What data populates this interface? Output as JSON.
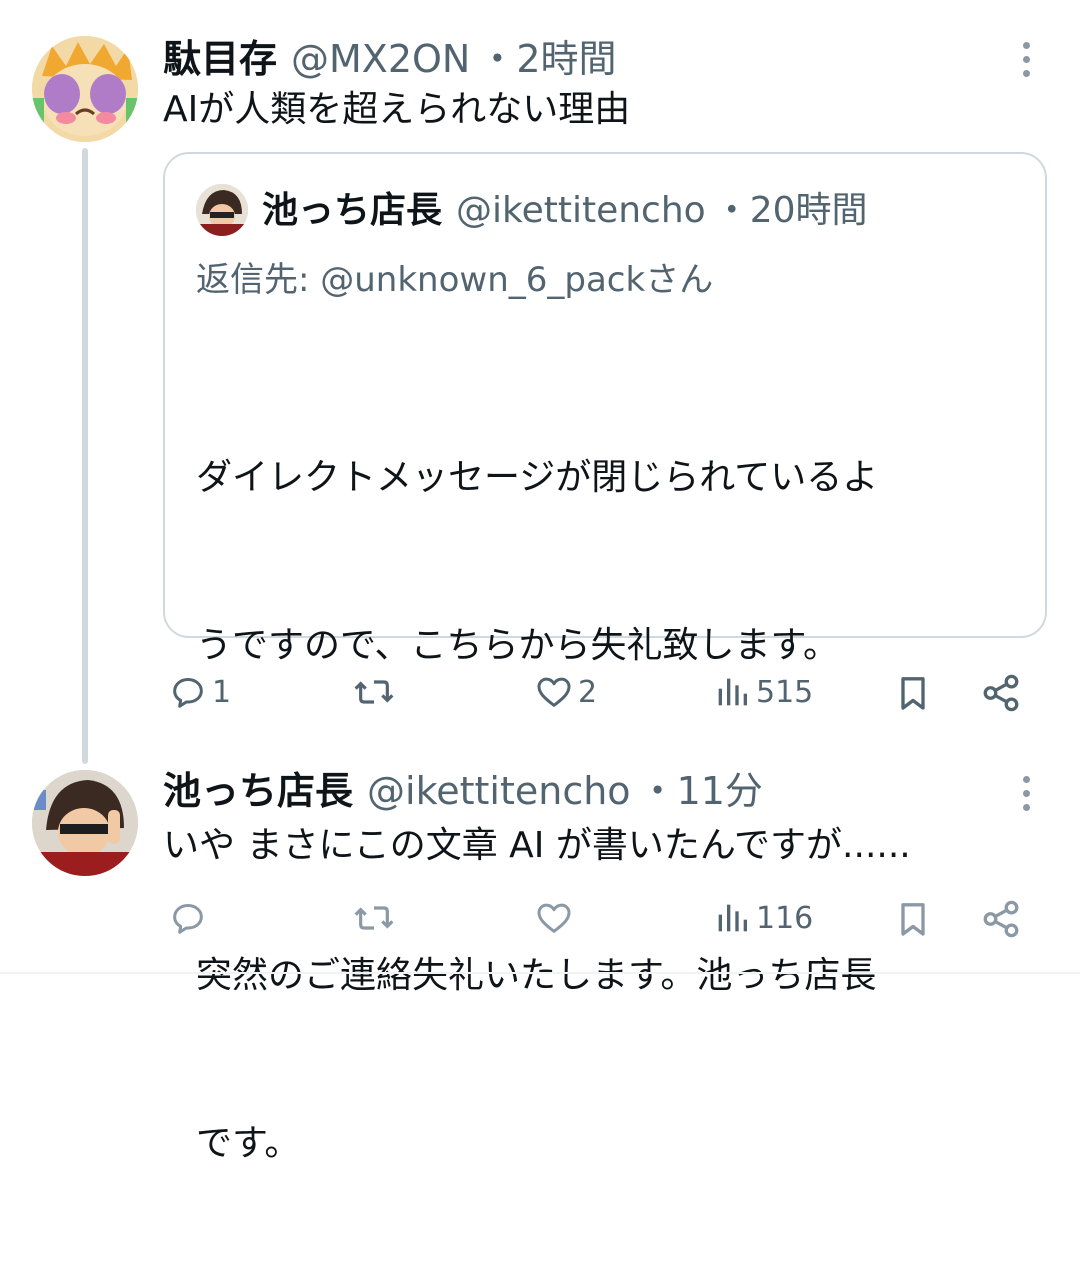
{
  "tweet1": {
    "display_name": "駄目存",
    "handle": "@MX2ON",
    "time": "・2時間",
    "text": "AIが人類を超えられない理由",
    "quote": {
      "display_name": "池っち店長",
      "handle": "@ikettitencho",
      "time": "・20時間",
      "reply_to": "返信先: @unknown_6_packさん",
      "line1": "ダイレクトメッセージが閉じられているよ",
      "line2": "うですので、こちらから失礼致します。",
      "line3": "突然のご連絡失礼いたします。池っち店長",
      "line4": "です。"
    },
    "actions": {
      "reply_count": "1",
      "retweet_count": "",
      "like_count": "2",
      "view_count": "515"
    }
  },
  "tweet2": {
    "display_name": "池っち店長",
    "handle": "@ikettitencho",
    "time": "・11分",
    "text": "いや まさにこの文章 AI が書いたんですが......",
    "actions": {
      "reply_count": "",
      "retweet_count": "",
      "like_count": "",
      "view_count": "116"
    }
  },
  "icons": {
    "reply": "reply-icon",
    "retweet": "retweet-icon",
    "like": "heart-icon",
    "views": "views-icon",
    "bookmark": "bookmark-icon",
    "share": "share-icon",
    "more": "more-options-icon"
  },
  "colors": {
    "text": "#0f1419",
    "secondary": "#536471",
    "border": "#cfd9de"
  }
}
